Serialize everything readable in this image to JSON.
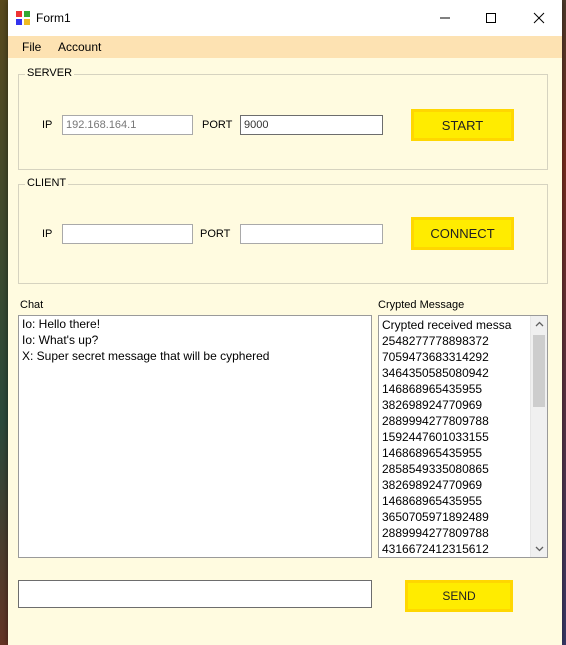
{
  "window": {
    "title": "Form1"
  },
  "menu": [
    {
      "label": "File"
    },
    {
      "label": "Account"
    }
  ],
  "server": {
    "group_title": "SERVER",
    "ip_label": "IP",
    "ip_value": "192.168.164.1",
    "port_label": "PORT",
    "port_value": "9000",
    "start_label": "START"
  },
  "client": {
    "group_title": "CLIENT",
    "ip_label": "IP",
    "ip_value": "",
    "port_label": "PORT",
    "port_value": "",
    "connect_label": "CONNECT"
  },
  "chat": {
    "label": "Chat",
    "messages": [
      "Io: Hello there!",
      "Io: What's up?",
      "X: Super secret message that will be cyphered"
    ]
  },
  "crypted": {
    "label": "Crypted Message",
    "items": [
      "Crypted received messa",
      "2548277778898372",
      "7059473683314292",
      "3464350585080942",
      "146868965435955",
      "382698924770969",
      "2889994277809788",
      "1592447601033155",
      "146868965435955",
      "2858549335080865",
      "382698924770969",
      "146868965435955",
      "3650705971892489",
      "2889994277809788",
      "4316672412315612"
    ]
  },
  "compose": {
    "value": "",
    "send_label": "SEND"
  },
  "colors": {
    "accent": "#ffec00",
    "accent_border": "#ffd700",
    "form_bg": "#fffbe0",
    "menu_bg": "#fde2b2"
  }
}
